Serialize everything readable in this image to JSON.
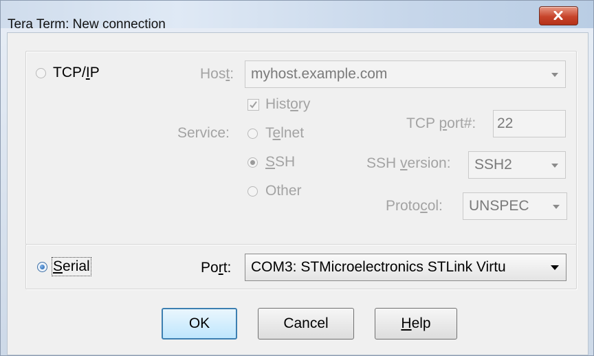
{
  "window": {
    "title": "Tera Term: New connection"
  },
  "tcpip": {
    "radio_label_pre": "TCP/",
    "radio_label_ul": "I",
    "radio_label_post": "P",
    "host_label_pre": "Hos",
    "host_label_ul": "t",
    "host_label_post": ":",
    "host_value": "myhost.example.com",
    "history_pre": "Hist",
    "history_ul": "o",
    "history_post": "ry",
    "service_label": "Service:",
    "telnet_pre": "T",
    "telnet_ul": "e",
    "telnet_post": "lnet",
    "ssh_ul": "S",
    "ssh_post": "SH",
    "other_label": "Other",
    "tcp_port_pre": "TCP ",
    "tcp_port_ul": "p",
    "tcp_port_post": "ort#:",
    "tcp_port_value": "22",
    "ssh_version_pre": "SSH ",
    "ssh_version_ul": "v",
    "ssh_version_post": "ersion:",
    "ssh_version_value": "SSH2",
    "protocol_pre": "Proto",
    "protocol_ul": "c",
    "protocol_post": "ol:",
    "protocol_value": "UNSPEC"
  },
  "serial": {
    "radio_label_ul": "S",
    "radio_label_post": "erial",
    "port_label_pre": "Po",
    "port_label_ul": "r",
    "port_label_post": "t:",
    "port_value": "COM3: STMicroelectronics STLink Virtu"
  },
  "buttons": {
    "ok_label": "OK",
    "cancel_label": "Cancel",
    "help_ul": "H",
    "help_post": "elp"
  }
}
